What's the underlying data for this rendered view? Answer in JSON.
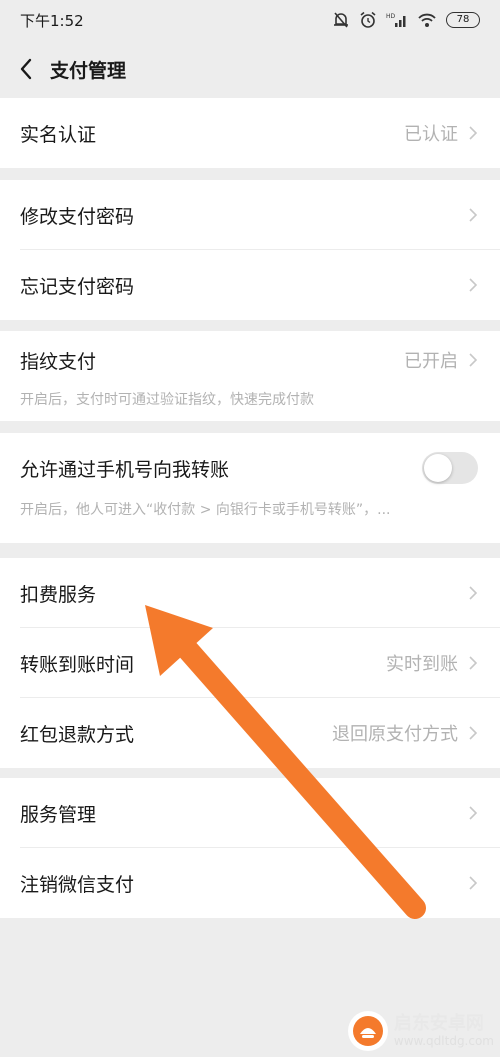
{
  "status_bar": {
    "time": "下午1:52",
    "battery": "78"
  },
  "nav": {
    "title": "支付管理"
  },
  "groups": {
    "g1": {
      "real_name": {
        "label": "实名认证",
        "value": "已认证"
      }
    },
    "g2": {
      "change_pwd": {
        "label": "修改支付密码"
      },
      "forgot_pwd": {
        "label": "忘记支付密码"
      }
    },
    "g3": {
      "fingerprint": {
        "label": "指纹支付",
        "value": "已开启",
        "hint": "开启后，支付时可通过验证指纹，快速完成付款"
      }
    },
    "g4": {
      "phone_transfer": {
        "label": "允许通过手机号向我转账",
        "hint": "开启后，他人可进入“收付款 > 向银行卡或手机号转账”，...",
        "enabled": false
      }
    },
    "g5": {
      "deduction": {
        "label": "扣费服务"
      },
      "arrival_time": {
        "label": "转账到账时间",
        "value": "实时到账"
      },
      "red_packet_refund": {
        "label": "红包退款方式",
        "value": "退回原支付方式"
      }
    },
    "g6": {
      "service_mgmt": {
        "label": "服务管理"
      },
      "cancel_pay": {
        "label": "注销微信支付"
      }
    }
  },
  "colors": {
    "arrow": "#f47a2c",
    "background": "#ededed",
    "secondary_text": "#b2b2b2"
  },
  "watermark": {
    "title": "启东安卓网",
    "url": "www.qdltdg.com"
  }
}
